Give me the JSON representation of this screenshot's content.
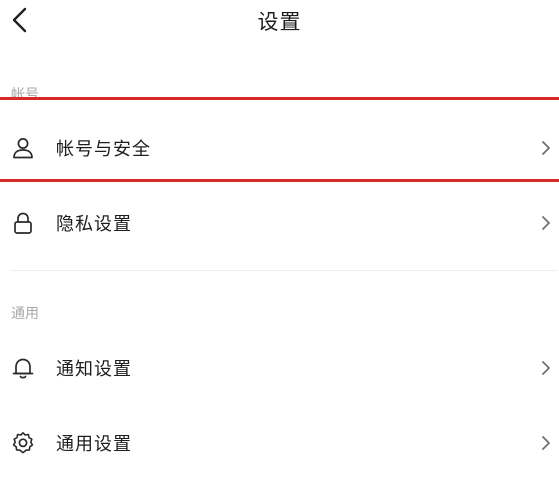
{
  "header": {
    "title": "设置",
    "back_icon": "chevron-left-icon"
  },
  "sections": [
    {
      "label": "帐号",
      "items": [
        {
          "label": "帐号与安全",
          "icon": "person-icon"
        },
        {
          "label": "隐私设置",
          "icon": "lock-icon"
        }
      ]
    },
    {
      "label": "通用",
      "items": [
        {
          "label": "通知设置",
          "icon": "bell-icon"
        },
        {
          "label": "通用设置",
          "icon": "gear-icon"
        }
      ]
    }
  ],
  "colors": {
    "highlight": "#d42a2a",
    "section_label": "#a8a8a8",
    "text": "#1e1e1e"
  }
}
